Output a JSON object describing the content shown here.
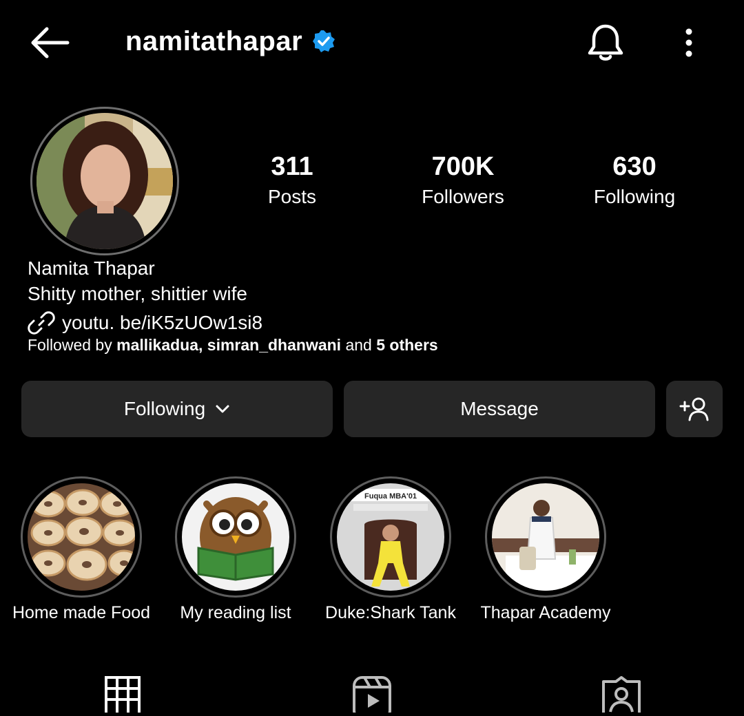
{
  "header": {
    "username": "namitathapar",
    "verified": true,
    "icons": [
      "back-arrow-icon",
      "verified-badge-icon",
      "bell-icon",
      "more-vertical-icon"
    ]
  },
  "stats": [
    {
      "value": "311",
      "label": "Posts"
    },
    {
      "value": "700K",
      "label": "Followers"
    },
    {
      "value": "630",
      "label": "Following"
    }
  ],
  "bio": {
    "name": "Namita Thapar",
    "text": "Shitty mother,  shittier wife",
    "link": "youtu. be/iK5zUOw1si8",
    "followed_prefix": "Followed by",
    "followed_user1": "mallikadua,",
    "followed_user2": "simran_dhanwani",
    "followed_and": "and",
    "followed_others": "5 others"
  },
  "buttons": {
    "following": "Following",
    "message": "Message"
  },
  "highlights": [
    {
      "label": "Home made Food"
    },
    {
      "label": "My reading list"
    },
    {
      "label": "Duke:Shark Tank",
      "image_text": "Fuqua MBA'01"
    },
    {
      "label": "Thapar Academy"
    }
  ],
  "tabs": [
    "grid-icon",
    "reels-icon",
    "tagged-icon"
  ],
  "colors": {
    "background": "#000000",
    "button": "#262626",
    "verified": "#1d9bf0"
  }
}
